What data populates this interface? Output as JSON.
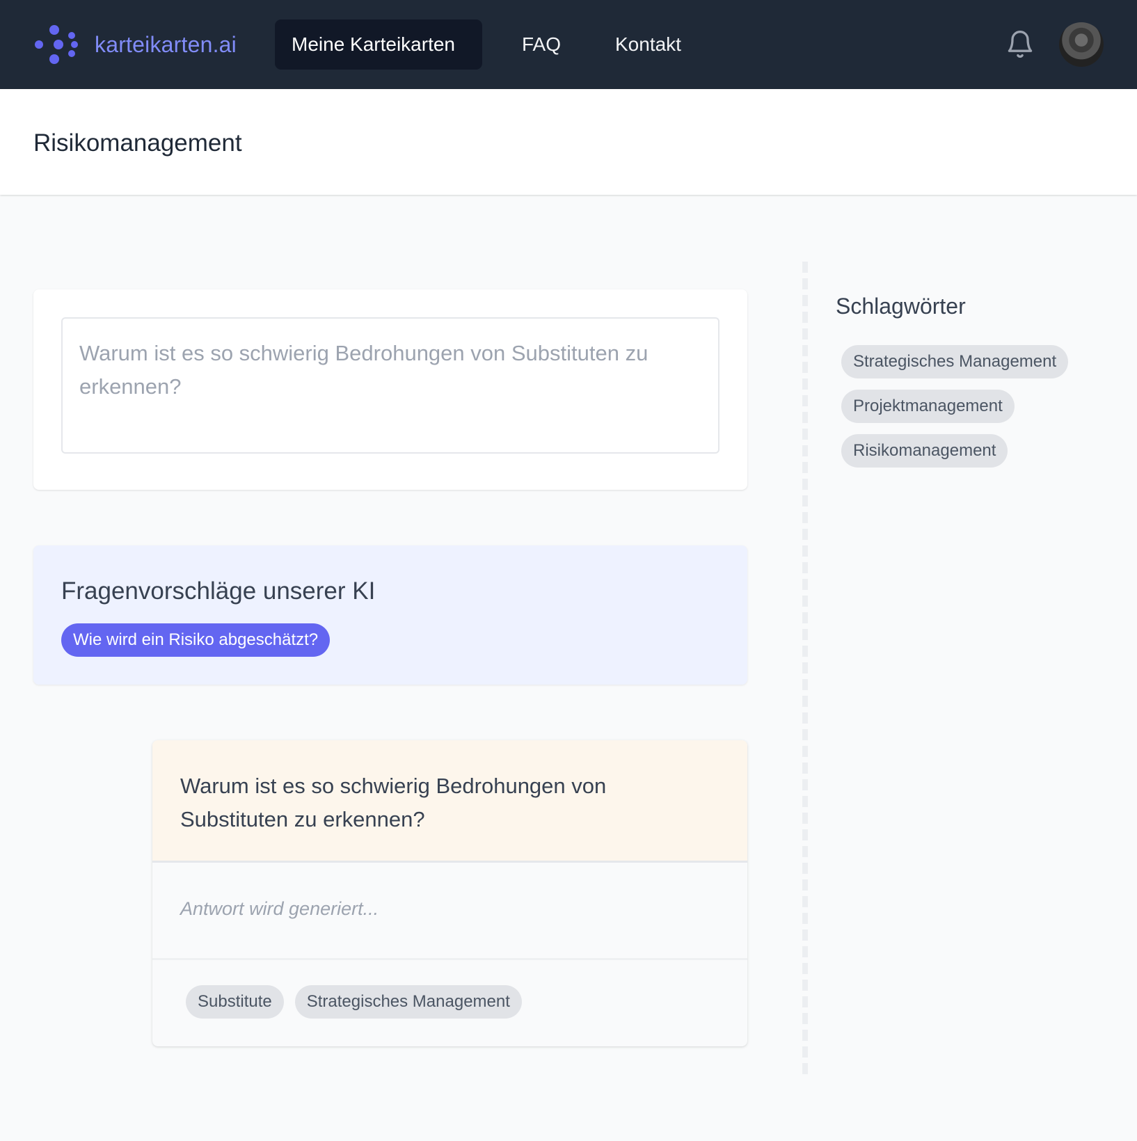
{
  "navbar": {
    "brand": "karteikarten.ai",
    "items": [
      {
        "label": "Meine Karteikarten",
        "active": true
      },
      {
        "label": "FAQ",
        "active": false
      },
      {
        "label": "Kontakt",
        "active": false
      }
    ],
    "icons": {
      "logo": "dots-logo-icon",
      "notifications": "bell-icon",
      "avatar": "user-avatar"
    },
    "colors": {
      "background": "#1f2937",
      "brand": "#818cf8",
      "active_bg": "#111827"
    }
  },
  "header": {
    "title": "Risikomanagement"
  },
  "question_input": {
    "placeholder": "Warum ist es so schwierig Bedrohungen von Substituten zu erkennen?",
    "value": ""
  },
  "suggestions": {
    "title": "Fragenvorschläge unserer KI",
    "items": [
      "Wie wird ein Risiko abgeschätzt?"
    ],
    "colors": {
      "background": "#eef2ff",
      "chip": "#6366f1"
    }
  },
  "flashcard": {
    "question": "Warum ist es so schwierig Bedrohungen von Substituten zu erkennen?",
    "answer_status": "Antwort wird generiert...",
    "tags": [
      "Substitute",
      "Strategisches Management"
    ],
    "colors": {
      "question_bg": "#fdf6ec"
    }
  },
  "sidebar": {
    "title": "Schlagwörter",
    "tags": [
      "Strategisches Management",
      "Projektmanagement",
      "Risikomanagement"
    ]
  }
}
